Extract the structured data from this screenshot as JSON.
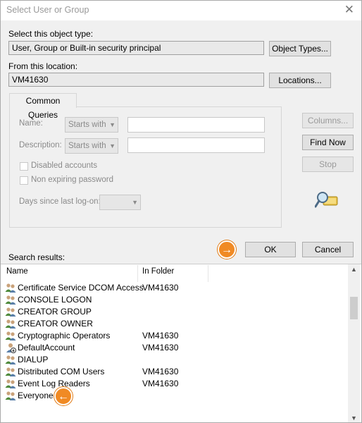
{
  "dialog": {
    "title": "Select User or Group",
    "close_glyph": "✕"
  },
  "object_type": {
    "label": "Select this object type:",
    "value": "User, Group or Built-in security principal",
    "button": "Object Types..."
  },
  "location": {
    "label": "From this location:",
    "value": "VM41630",
    "button": "Locations..."
  },
  "common_queries": {
    "tab_label": "Common Queries",
    "name_label": "Name:",
    "name_mode": "Starts with",
    "name_value": "",
    "description_label": "Description:",
    "description_mode": "Starts with",
    "description_value": "",
    "disabled_accounts": "Disabled accounts",
    "non_expiring_password": "Non expiring password",
    "days_since_logon_label": "Days since last log-on:",
    "days_since_logon_value": ""
  },
  "side_buttons": {
    "columns": "Columns...",
    "find_now": "Find Now",
    "stop": "Stop"
  },
  "actions": {
    "ok": "OK",
    "cancel": "Cancel"
  },
  "results": {
    "label": "Search results:",
    "columns": [
      "Name",
      "In Folder"
    ],
    "rows": [
      {
        "name": "Certificate Service DCOM Access",
        "folder": "VM41630",
        "icon": "group-icon"
      },
      {
        "name": "CONSOLE LOGON",
        "folder": "",
        "icon": "group-icon"
      },
      {
        "name": "CREATOR GROUP",
        "folder": "",
        "icon": "group-icon"
      },
      {
        "name": "CREATOR OWNER",
        "folder": "",
        "icon": "group-icon"
      },
      {
        "name": "Cryptographic Operators",
        "folder": "VM41630",
        "icon": "group-icon"
      },
      {
        "name": "DefaultAccount",
        "folder": "VM41630",
        "icon": "user-disabled-icon"
      },
      {
        "name": "DIALUP",
        "folder": "",
        "icon": "group-icon"
      },
      {
        "name": "Distributed COM Users",
        "folder": "VM41630",
        "icon": "group-icon"
      },
      {
        "name": "Event Log Readers",
        "folder": "VM41630",
        "icon": "group-icon"
      },
      {
        "name": "Everyone",
        "folder": "",
        "icon": "group-icon"
      }
    ]
  },
  "annotations": {
    "ok_arrow": "→",
    "everyone_arrow": "←",
    "accent_color": "#f08a24"
  }
}
